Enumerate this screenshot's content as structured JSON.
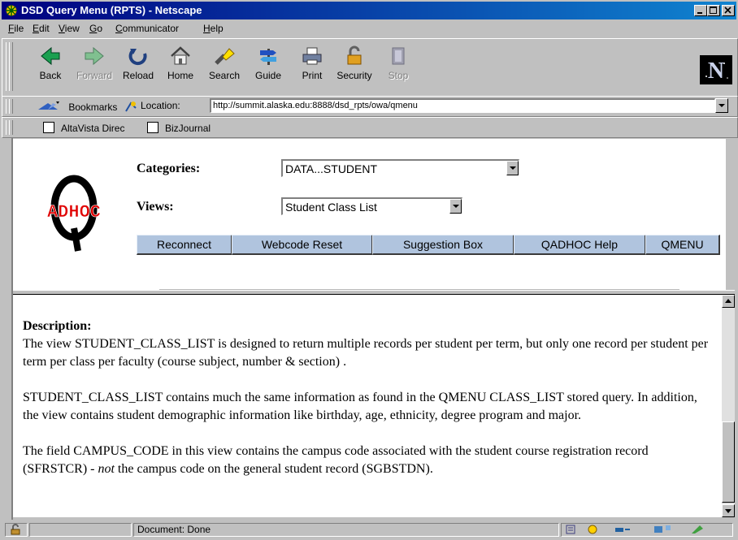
{
  "window": {
    "title": "DSD Query Menu (RPTS) - Netscape"
  },
  "menu": [
    {
      "pre": "",
      "u": "F",
      "post": "ile"
    },
    {
      "pre": "",
      "u": "E",
      "post": "dit"
    },
    {
      "pre": "",
      "u": "V",
      "post": "iew"
    },
    {
      "pre": "",
      "u": "G",
      "post": "o"
    },
    {
      "pre": "",
      "u": "C",
      "post": "ommunicator"
    },
    {
      "pre": "",
      "u": "H",
      "post": "elp"
    }
  ],
  "toolbar": {
    "back": "Back",
    "forward": "Forward",
    "reload": "Reload",
    "home": "Home",
    "search": "Search",
    "guide": "Guide",
    "print": "Print",
    "security": "Security",
    "stop": "Stop"
  },
  "location": {
    "bookmarks": "Bookmarks",
    "label": "Location:",
    "url": "http://summit.alaska.edu:8888/dsd_rpts/owa/qmenu"
  },
  "personal": {
    "item1": "AltaVista Direc",
    "item2": "BizJournal"
  },
  "page": {
    "logo_text": "ADHOC",
    "categories_label": "Categories:",
    "categories_value": "DATA...STUDENT",
    "views_label": "Views:",
    "views_value": "Student Class List",
    "buttons": [
      "Reconnect",
      "Webcode Reset",
      "Suggestion Box",
      "QADHOC Help",
      "QMENU"
    ]
  },
  "description": {
    "heading": "Description:",
    "p1": "The view STUDENT_CLASS_LIST is designed to return multiple records per student per term, but only one record per student per term per class per faculty (course subject, number & section) .",
    "p2": "STUDENT_CLASS_LIST contains much the same information as found in the QMENU CLASS_LIST stored query. In addition, the view contains student demographic information like birthday, age, ethnicity, degree program and major.",
    "p3_a": "The field CAMPUS_CODE in this view contains the campus code associated with the student course registration record (SFRSTCR) - ",
    "p3_em": "not",
    "p3_b": " the campus code on the general student record (SGBSTDN)."
  },
  "status": {
    "text": "Document: Done"
  }
}
